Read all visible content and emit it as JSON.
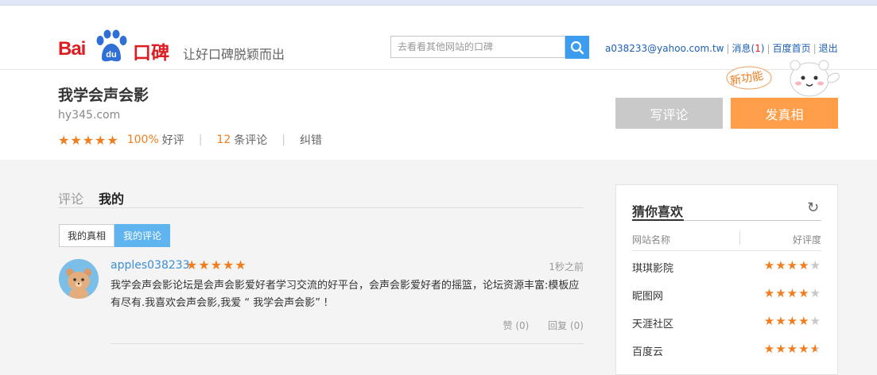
{
  "header": {
    "logo_text_left": "Bai",
    "logo_text_du": "du",
    "logo_text_right": "口碑",
    "slogan": "让好口碑脱颖而出",
    "search_placeholder": "去看看其他网站的口碑",
    "user_email": "a038233@yahoo.com.tw",
    "messages_label": "消息(",
    "messages_count": "1",
    "messages_close": ")",
    "home_link": "百度首页",
    "logout_link": "退出",
    "colors": {
      "brand_red": "#de1d22",
      "search_blue": "#3b9cf0"
    }
  },
  "site": {
    "name": "我学会声会影",
    "domain": "hy345.com",
    "stars": "★★★★★",
    "rating_percent": "100%",
    "rating_label": "好评",
    "review_count": "12",
    "review_label": "条评论",
    "report_label": "纠错",
    "write_review_button": "写评论",
    "post_truth_button": "发真相",
    "new_feature_badge": "新功能"
  },
  "tabs": {
    "reviews": "评论",
    "mine": "我的",
    "sub_truth": "我的真相",
    "sub_reviews": "我的评论"
  },
  "review": {
    "username": "apples038233",
    "stars": "★★★★★",
    "time": "1秒之前",
    "text": "我学会声会影论坛是会声会影爱好者学习交流的好平台，会声会影爱好者的摇篮，论坛资源丰富:模板应有尽有.我喜欢会声会影,我爱 “ 我学会声会影” !",
    "like_label": "赞 (0)",
    "reply_label": "回复 (0)"
  },
  "sidebar": {
    "title": "猜你喜欢",
    "col_site": "网站名称",
    "col_rating": "好评度",
    "items": [
      {
        "name": "琪琪影院",
        "rating": 4
      },
      {
        "name": "昵图网",
        "rating": 4
      },
      {
        "name": "天涯社区",
        "rating": 4
      },
      {
        "name": "百度云",
        "rating": 4.5
      }
    ]
  }
}
